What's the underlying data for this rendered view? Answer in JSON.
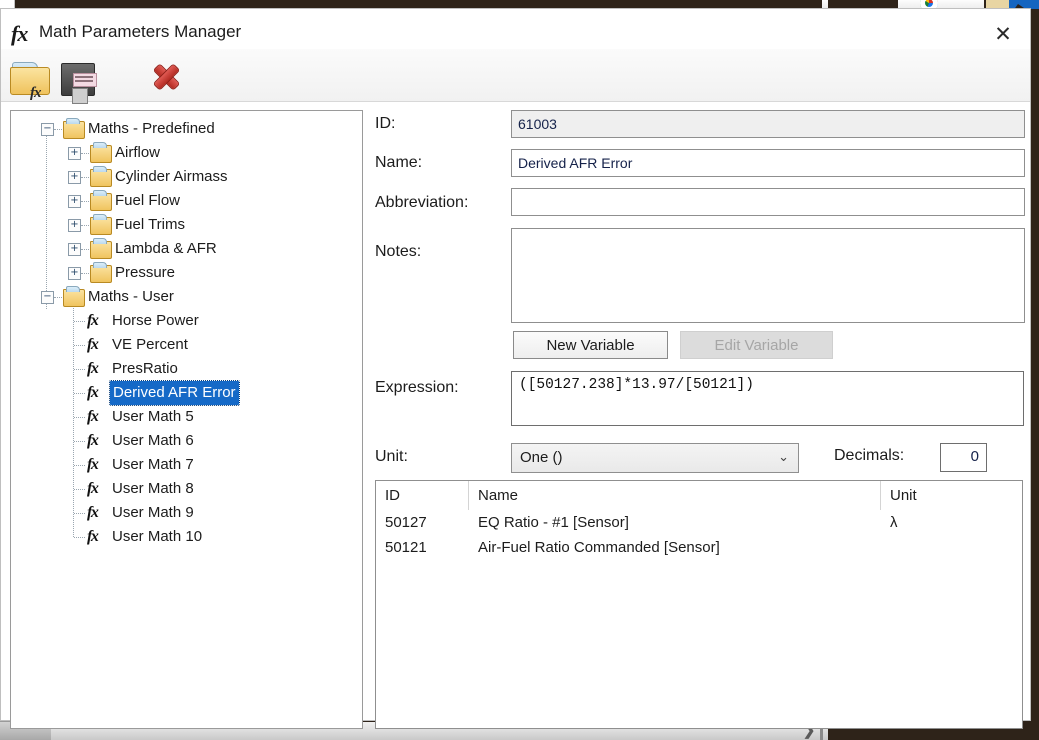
{
  "window": {
    "title": "Math Parameters Manager",
    "title_icon": "fx-icon",
    "close_label": "✕"
  },
  "toolbar": {
    "buttons": [
      {
        "name": "open-folder-fx-button",
        "icon": "folder-fx-icon",
        "fx_text": "fx"
      },
      {
        "name": "save-button",
        "icon": "floppy-disk-icon"
      },
      {
        "name": "delete-button",
        "icon": "red-x-icon"
      }
    ]
  },
  "tree": {
    "nodes": [
      {
        "label": "Maths - Predefined",
        "depth": 0,
        "type": "folder",
        "expander": "−",
        "selected": false
      },
      {
        "label": "Airflow",
        "depth": 1,
        "type": "folder",
        "expander": "+",
        "selected": false
      },
      {
        "label": "Cylinder Airmass",
        "depth": 1,
        "type": "folder",
        "expander": "+",
        "selected": false
      },
      {
        "label": "Fuel Flow",
        "depth": 1,
        "type": "folder",
        "expander": "+",
        "selected": false
      },
      {
        "label": "Fuel Trims",
        "depth": 1,
        "type": "folder",
        "expander": "+",
        "selected": false
      },
      {
        "label": "Lambda & AFR",
        "depth": 1,
        "type": "folder",
        "expander": "+",
        "selected": false
      },
      {
        "label": "Pressure",
        "depth": 1,
        "type": "folder",
        "expander": "+",
        "selected": false
      },
      {
        "label": "Maths - User",
        "depth": 0,
        "type": "folder",
        "expander": "−",
        "selected": false
      },
      {
        "label": "Horse Power",
        "depth": 1,
        "type": "fx",
        "expander": "",
        "selected": false
      },
      {
        "label": "VE Percent",
        "depth": 1,
        "type": "fx",
        "expander": "",
        "selected": false
      },
      {
        "label": "PresRatio",
        "depth": 1,
        "type": "fx",
        "expander": "",
        "selected": false
      },
      {
        "label": "Derived AFR Error",
        "depth": 1,
        "type": "fx",
        "expander": "",
        "selected": true
      },
      {
        "label": "User Math 5",
        "depth": 1,
        "type": "fx",
        "expander": "",
        "selected": false
      },
      {
        "label": "User Math 6",
        "depth": 1,
        "type": "fx",
        "expander": "",
        "selected": false
      },
      {
        "label": "User Math 7",
        "depth": 1,
        "type": "fx",
        "expander": "",
        "selected": false
      },
      {
        "label": "User Math 8",
        "depth": 1,
        "type": "fx",
        "expander": "",
        "selected": false
      },
      {
        "label": "User Math 9",
        "depth": 1,
        "type": "fx",
        "expander": "",
        "selected": false
      },
      {
        "label": "User Math 10",
        "depth": 1,
        "type": "fx",
        "expander": "",
        "selected": false
      }
    ]
  },
  "form": {
    "id_label": "ID:",
    "id_value": "61003",
    "name_label": "Name:",
    "name_value": "Derived AFR Error",
    "abbreviation_label": "Abbreviation:",
    "abbreviation_value": "",
    "notes_label": "Notes:",
    "notes_value": "",
    "new_variable_label": "New Variable",
    "edit_variable_label": "Edit Variable",
    "expression_label": "Expression:",
    "expression_value": "([50127.238]*13.97/[50121])",
    "unit_label": "Unit:",
    "unit_value": "One ()",
    "unit_caret": "⌄",
    "decimals_label": "Decimals:",
    "decimals_value": "0"
  },
  "variables_table": {
    "columns": [
      "ID",
      "Name",
      "Unit"
    ],
    "rows": [
      {
        "id": "50127",
        "name": "EQ Ratio - #1 [Sensor]",
        "unit": "λ"
      },
      {
        "id": "50121",
        "name": "Air-Fuel Ratio Commanded [Sensor]",
        "unit": ""
      }
    ]
  },
  "background": {
    "bottom_chevron": "❯"
  },
  "colors": {
    "selection_blue": "#1569c7",
    "desktop_brown": "#2e2319",
    "folder_yellow": "#f0c45f",
    "delete_red": "#b32b22"
  }
}
